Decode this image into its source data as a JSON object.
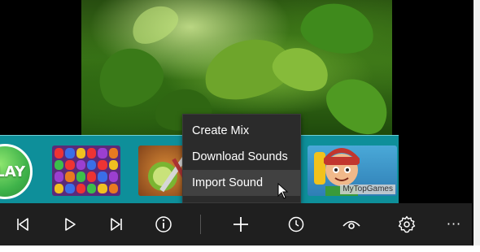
{
  "banner": {
    "play_label": "LAY",
    "watermark": "MyTopGames"
  },
  "context_menu": {
    "items": [
      {
        "label": "Create Mix"
      },
      {
        "label": "Download Sounds"
      },
      {
        "label": "Import Sound",
        "hovered": true
      }
    ]
  },
  "app_bar": {
    "buttons": [
      "previous-icon",
      "play-icon",
      "next-icon",
      "info-icon",
      "add-icon",
      "clock-icon",
      "eye-icon",
      "settings-icon",
      "more-icon"
    ],
    "more_label": "···"
  },
  "colors": {
    "banner_bg": "#0e8f9a",
    "menu_bg": "#2b2b2b",
    "menu_hover": "#414141",
    "app_bar_bg": "#1f1f1f"
  }
}
